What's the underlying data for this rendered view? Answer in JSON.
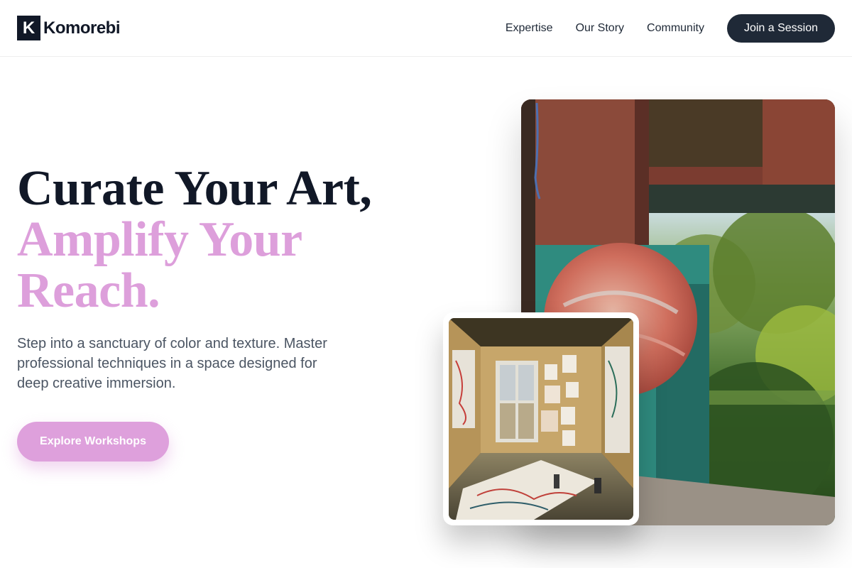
{
  "header": {
    "logo_mark": "K",
    "brand": "Komorebi",
    "nav": [
      "Expertise",
      "Our Story",
      "Community"
    ],
    "cta": "Join a Session"
  },
  "hero": {
    "title_line1": "Curate Your Art,",
    "title_line2": "Amplify Your",
    "title_line3": "Reach.",
    "subtitle": "Step into a sanctuary of color and texture. Master professional techniques in a space designed for deep creative immersion.",
    "cta": "Explore Workshops"
  },
  "colors": {
    "dark": "#111827",
    "accent": "#dea0dc",
    "body_text": "#4b5563"
  },
  "images": {
    "main": "studio-window-garden-photo",
    "inset": "art-studio-interior-photo"
  }
}
